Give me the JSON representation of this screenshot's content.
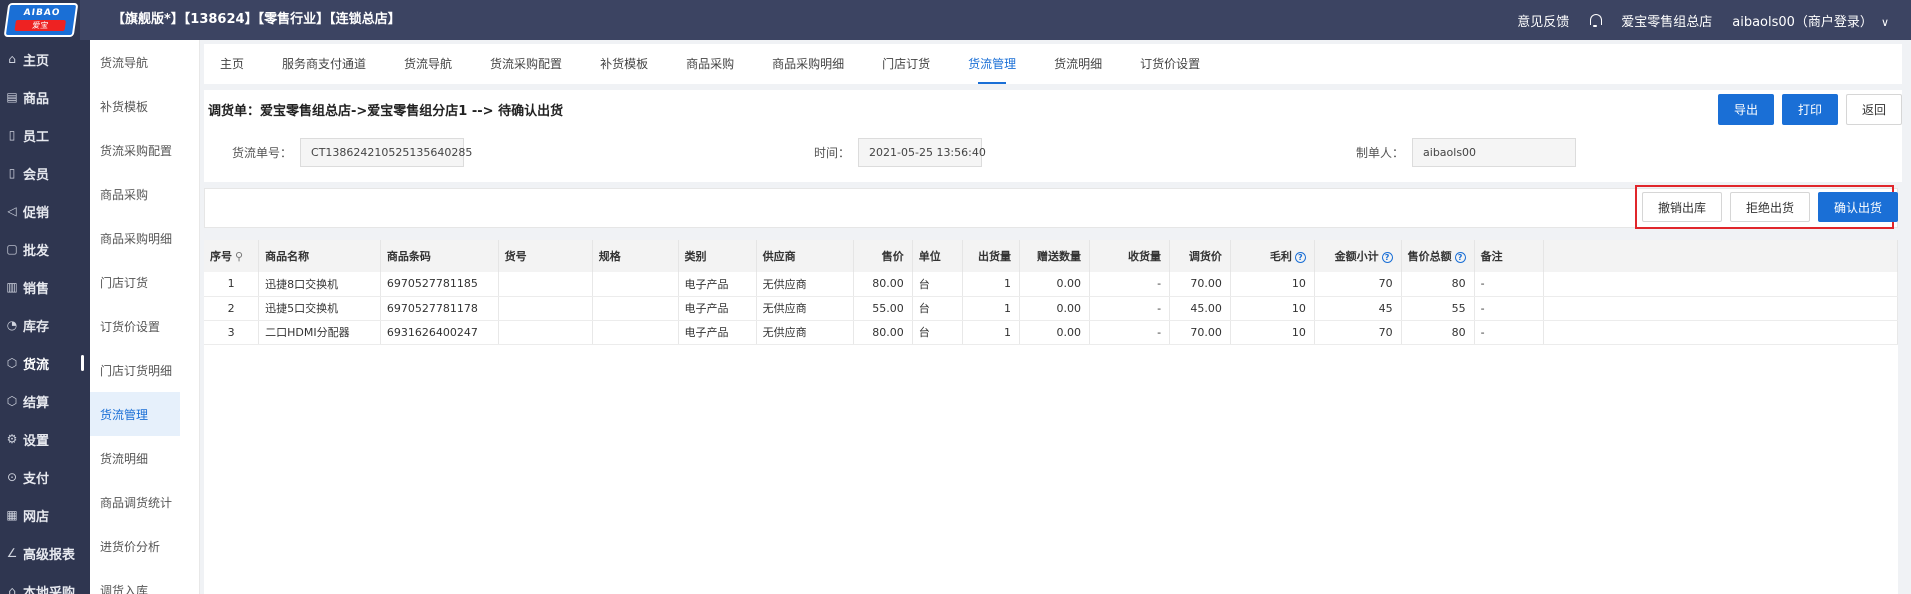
{
  "header": {
    "logo_text": "AIBAO",
    "logo_sub": "爱宝",
    "title": "【旗舰版*】【138624】【零售行业】【连锁总店】",
    "feedback": "意见反馈",
    "store_name": "爱宝零售组总店",
    "user": "aibaols00（商户登录）",
    "icons": [
      "bell-icon",
      "chevron-down-icon"
    ]
  },
  "nav": {
    "items": [
      {
        "label": "主页",
        "icon": "⌂"
      },
      {
        "label": "商品",
        "icon": "▤"
      },
      {
        "label": "员工",
        "icon": "▯"
      },
      {
        "label": "会员",
        "icon": "▯"
      },
      {
        "label": "促销",
        "icon": "◁"
      },
      {
        "label": "批发",
        "icon": "▢"
      },
      {
        "label": "销售",
        "icon": "▥"
      },
      {
        "label": "库存",
        "icon": "◔"
      },
      {
        "label": "货流",
        "icon": "⬡"
      },
      {
        "label": "结算",
        "icon": "⬡"
      },
      {
        "label": "设置",
        "icon": "⚙"
      },
      {
        "label": "支付",
        "icon": "⊙"
      },
      {
        "label": "网店",
        "icon": "▦"
      },
      {
        "label": "高级报表",
        "icon": "∠"
      },
      {
        "label": "本地采购",
        "icon": "⌂"
      }
    ],
    "active": "货流"
  },
  "subnav": {
    "items": [
      "货流导航",
      "补货模板",
      "货流采购配置",
      "商品采购",
      "商品采购明细",
      "门店订货",
      "订货价设置",
      "门店订货明细",
      "货流管理",
      "货流明细",
      "商品调货统计",
      "进货价分析",
      "调货入库"
    ],
    "active": "货流管理"
  },
  "tabs": {
    "items": [
      "主页",
      "服务商支付通道",
      "货流导航",
      "货流采购配置",
      "补货模板",
      "商品采购",
      "商品采购明细",
      "门店订货",
      "货流管理",
      "货流明细",
      "订货价设置"
    ],
    "active": "货流管理"
  },
  "doc": {
    "title": "调货单：爱宝零售组总店->爱宝零售组分店1 --> 待确认出货",
    "buttons": {
      "export": "导出",
      "print": "打印",
      "back": "返回"
    },
    "fields": {
      "order_no_label": "货流单号：",
      "order_no": "CT138624210525135640285",
      "time_label": "时间：",
      "time": "2021-05-25 13:56:40",
      "maker_label": "制单人：",
      "maker": "aibaols00"
    }
  },
  "actions": {
    "revoke": "撤销出库",
    "reject": "拒绝出货",
    "confirm": "确认出货"
  },
  "table": {
    "headers": [
      "序号",
      "商品名称",
      "商品条码",
      "货号",
      "规格",
      "类别",
      "供应商",
      "售价",
      "单位",
      "出货量",
      "赠送数量",
      "收货量",
      "调货价",
      "毛利",
      "金额小计",
      "售价总额",
      "备注"
    ],
    "rows": [
      [
        "1",
        "迅捷8口交换机",
        "6970527781185",
        "",
        "",
        "电子产品",
        "无供应商",
        "80.00",
        "台",
        "1",
        "0.00",
        "-",
        "70.00",
        "10",
        "70",
        "80",
        "-"
      ],
      [
        "2",
        "迅捷5口交换机",
        "6970527781178",
        "",
        "",
        "电子产品",
        "无供应商",
        "55.00",
        "台",
        "1",
        "0.00",
        "-",
        "45.00",
        "10",
        "45",
        "55",
        "-"
      ],
      [
        "3",
        "二口HDMI分配器",
        "6931626400247",
        "",
        "",
        "电子产品",
        "无供应商",
        "80.00",
        "台",
        "1",
        "0.00",
        "-",
        "70.00",
        "10",
        "70",
        "80",
        "-"
      ]
    ]
  }
}
